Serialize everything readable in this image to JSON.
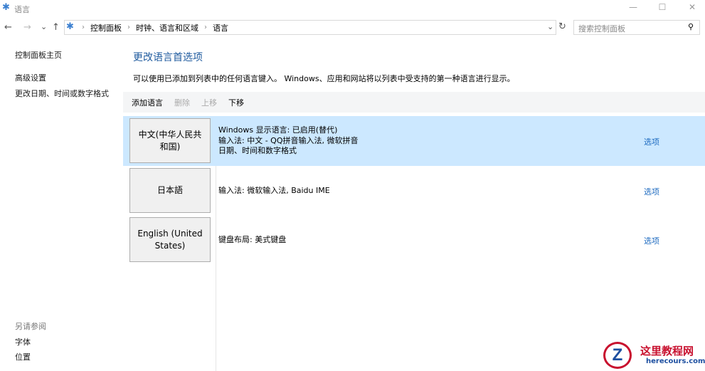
{
  "window": {
    "title": "语言",
    "minimize": "—",
    "maximize": "☐",
    "close": "✕"
  },
  "nav": {
    "back": "←",
    "forward": "→",
    "recent": "⌄",
    "up": "↑",
    "refresh": "↻",
    "dropdown": "⌄"
  },
  "breadcrumb": [
    "控制面板",
    "时钟、语言和区域",
    "语言"
  ],
  "search": {
    "placeholder": "搜索控制面板"
  },
  "sidebar": {
    "items": [
      "控制面板主页",
      "高级设置",
      "更改日期、时间或数字格式"
    ],
    "see_also": "另请参阅",
    "see_also_items": [
      "字体",
      "位置"
    ]
  },
  "main": {
    "title": "更改语言首选项",
    "description": "可以使用已添加到列表中的任何语言键入。 Windows、应用和网站将以列表中受支持的第一种语言进行显示。",
    "toolbar": {
      "add": "添加语言",
      "remove": "删除",
      "up": "上移",
      "down": "下移"
    },
    "languages": [
      {
        "name": "中文(中华人民共和国)",
        "details": [
          "Windows 显示语言: 已启用(替代)",
          "输入法: 中文 - QQ拼音输入法, 微软拼音",
          "日期、时间和数字格式"
        ],
        "options": "选项"
      },
      {
        "name": "日本語",
        "details": [
          "输入法: 微软输入法, Baidu IME"
        ],
        "options": "选项"
      },
      {
        "name": "English (United States)",
        "details": [
          "键盘布局: 美式键盘"
        ],
        "options": "选项"
      }
    ]
  },
  "watermark": {
    "name": "这里教程网",
    "url": "herecours.com"
  }
}
